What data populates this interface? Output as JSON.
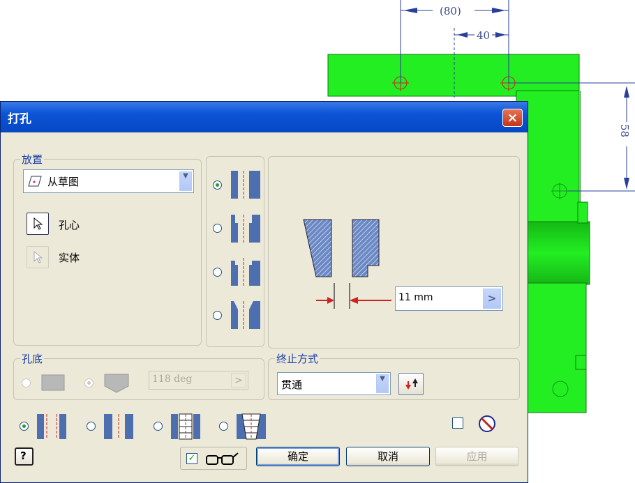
{
  "cad": {
    "dim_80": "(80)",
    "dim_40": "40",
    "dim_58": "58",
    "part_color": "#22ee22"
  },
  "dialog": {
    "title": "打孔",
    "close_label": "×",
    "placement": {
      "group_label": "放置",
      "source_value": "从草图",
      "center_label": "孔心",
      "solid_label": "实体"
    },
    "hole_types": {
      "selected_index": 0
    },
    "preview": {
      "diameter_value": "11 mm",
      "arrow_label": ">"
    },
    "bottom": {
      "group_label": "孔底",
      "angle_value": "118 deg",
      "angle_btn": ">"
    },
    "termination": {
      "group_label": "终止方式",
      "value": "贯通"
    },
    "thread_types": {
      "selected_index": 0
    },
    "footer": {
      "help_label": "?",
      "ok_label": "确定",
      "cancel_label": "取消",
      "apply_label": "应用",
      "checkbox_checked": true,
      "icons": {
        "glasses": "glasses-icon",
        "no": "no-symbol-icon",
        "flip": "flip-direction-icon"
      }
    },
    "colors": {
      "title_blue": "#0a54d6",
      "group_label": "#1c3fa6",
      "hatch": "#4d6fb0"
    }
  }
}
